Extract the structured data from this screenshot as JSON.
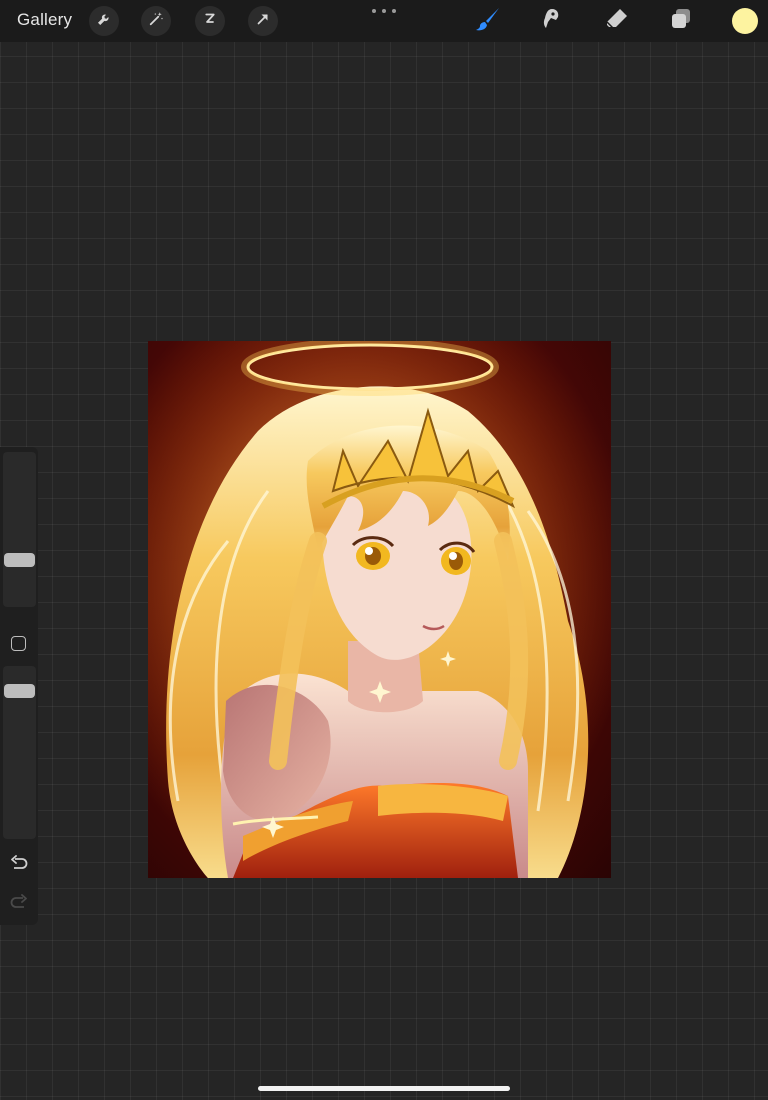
{
  "toolbar": {
    "gallery_label": "Gallery",
    "left_tools": [
      {
        "icon": "wrench-icon"
      },
      {
        "icon": "magic-wand-icon"
      },
      {
        "icon": "selection-icon"
      },
      {
        "icon": "transform-arrow-icon"
      }
    ],
    "more_icon": "more-dots-icon",
    "right_tools": [
      {
        "icon": "brush-icon",
        "active": true,
        "color": "#2f8cff"
      },
      {
        "icon": "smudge-icon",
        "active": false
      },
      {
        "icon": "eraser-icon",
        "active": false
      },
      {
        "icon": "layers-icon",
        "active": false
      }
    ],
    "current_color": "#fdf3a0"
  },
  "sidebar": {
    "brush_size_icon": "brush-size-slider",
    "modify_icon": "square-modify-icon",
    "opacity_icon": "opacity-slider",
    "undo_icon": "undo-icon",
    "redo_icon": "redo-icon"
  },
  "canvas": {
    "artwork": "anime-angel-illustration"
  },
  "colors": {
    "accent": "#2f8cff",
    "background": "#252525",
    "toolbar": "#1b1b1b"
  }
}
